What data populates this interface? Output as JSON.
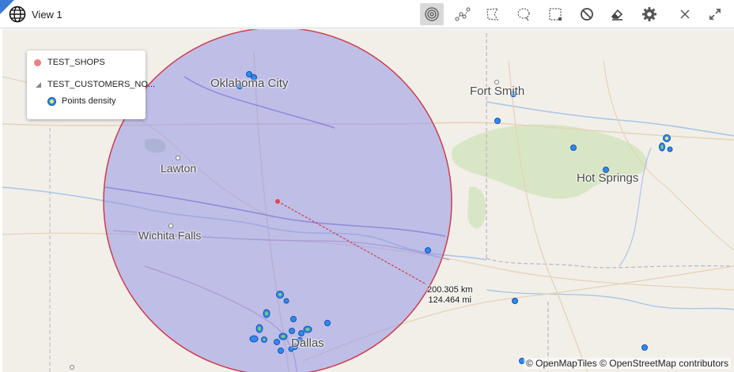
{
  "window": {
    "title": "View 1"
  },
  "toolbar": {
    "tools": [
      {
        "name": "radius-tool",
        "active": true
      },
      {
        "name": "polyline-tool",
        "active": false
      },
      {
        "name": "polygon-select-tool",
        "active": false
      },
      {
        "name": "lasso-select-tool",
        "active": false
      },
      {
        "name": "rectangle-select-tool",
        "active": false
      },
      {
        "name": "clear-selection-tool",
        "active": false
      },
      {
        "name": "eraser-tool",
        "active": false
      },
      {
        "name": "settings-tool",
        "active": false
      },
      {
        "name": "close-tool",
        "active": false
      },
      {
        "name": "expand-tool",
        "active": false
      }
    ]
  },
  "legend": {
    "shops_layer": "TEST_SHOPS",
    "customers_layer": "TEST_CUSTOMERS_NO...",
    "density_label": "Points density",
    "shops_color": "#f08080"
  },
  "map": {
    "places": {
      "oklahoma_city": "Oklahoma City",
      "fort_smith": "Fort Smith",
      "lawton": "Lawton",
      "hot_springs": "Hot Springs",
      "wichita_falls": "Wichita Falls",
      "dallas": "Dallas"
    },
    "radius_circle": {
      "fill": "#9595e6",
      "stroke": "#d03b4b"
    },
    "measurement": {
      "km": "200.305 km",
      "mi": "124.464 mi"
    },
    "attribution": "© OpenMapTiles  © OpenStreetMap contributors"
  }
}
